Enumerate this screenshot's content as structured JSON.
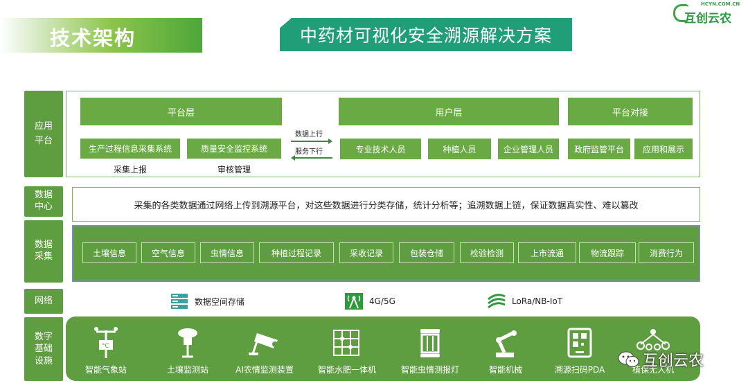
{
  "header": {
    "section_title": "技术架构",
    "main_title": "中药材可视化安全溯源解决方案",
    "logo_domain": "HCYN.COM.CN",
    "logo_name": "互创云农"
  },
  "layers": {
    "app": "应用\n平台",
    "dc": "数据\n中心",
    "coll": "数据\n采集",
    "net": "网络",
    "base": "数字\n基础\n设施"
  },
  "app_platform": {
    "platform_layer": "平台层",
    "user_layer": "用户层",
    "platform_docking": "平台对接",
    "production_system": "生产过程信息采集系统",
    "quality_system": "质量安全监控系统",
    "collect_report": "采集上报",
    "audit_manage": "审核管理",
    "data_up": "数据上行",
    "service_down": "服务下行",
    "users": [
      "专业技术人员",
      "种植人员",
      "企业管理人员"
    ],
    "docking": [
      "政府监管平台",
      "应用和展示"
    ]
  },
  "data_center_text": "采集的各类数据通过网络上传到溯源平台，对这些数据进行分类存储，统计分析等；追溯数据上链，保证数据真实性、难以篡改",
  "collection_items": [
    "土壤信息",
    "空气信息",
    "虫情信息",
    "种植过程记录",
    "采收记录",
    "包装仓储",
    "检验检测",
    "上市流通",
    "物流跟踪",
    "消费行为"
  ],
  "network": {
    "storage": "数据空间存储",
    "mobile": "4G/5G",
    "lora": "LoRa/NB-IoT"
  },
  "devices": [
    {
      "label": "智能气象站",
      "icon": "weather-station-icon"
    },
    {
      "label": "土壤监测站",
      "icon": "soil-monitor-icon"
    },
    {
      "label": "AI农情监测装置",
      "icon": "camera-icon"
    },
    {
      "label": "智能水肥一体机",
      "icon": "irrigation-icon"
    },
    {
      "label": "智能虫情测报灯",
      "icon": "insect-lamp-icon"
    },
    {
      "label": "智能机械",
      "icon": "robot-arm-icon"
    },
    {
      "label": "溯源扫码PDA",
      "icon": "qr-code-icon"
    },
    {
      "label": "植保无人机",
      "icon": "drone-icon"
    }
  ],
  "watermark": "互创云农",
  "colors": {
    "green": "#6aaa44",
    "dark_green": "#5f9e40",
    "teal": "#1f9e78"
  }
}
